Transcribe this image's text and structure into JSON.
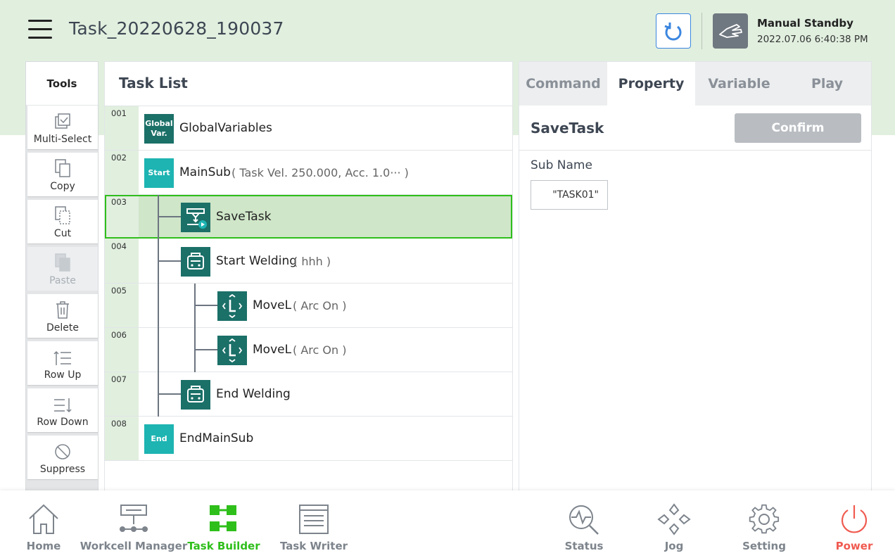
{
  "header": {
    "task_name": "Task_20220628_190037",
    "status_title": "Manual Standby",
    "status_time": "2022.07.06 6:40:38 PM"
  },
  "tools": {
    "title": "Tools",
    "items": [
      {
        "label": "Multi-Select",
        "icon": "multi-select-icon",
        "enabled": true
      },
      {
        "label": "Copy",
        "icon": "copy-icon",
        "enabled": true
      },
      {
        "label": "Cut",
        "icon": "cut-icon",
        "enabled": true
      },
      {
        "label": "Paste",
        "icon": "paste-icon",
        "enabled": false
      },
      {
        "label": "Delete",
        "icon": "trash-icon",
        "enabled": true
      },
      {
        "label": "Row Up",
        "icon": "row-up-icon",
        "enabled": true
      },
      {
        "label": "Row Down",
        "icon": "row-down-icon",
        "enabled": true
      },
      {
        "label": "Suppress",
        "icon": "suppress-icon",
        "enabled": true
      }
    ]
  },
  "task_list": {
    "title": "Task List",
    "rows": [
      {
        "num": "001",
        "node_text": "Global Var.",
        "label": "GlobalVariables",
        "arg": ""
      },
      {
        "num": "002",
        "node_text": "Start",
        "label": "MainSub",
        "arg": "( Task Vel. 250.000, Acc. 1.0··· )"
      },
      {
        "num": "003",
        "node_text": "",
        "label": "SaveTask",
        "arg": ""
      },
      {
        "num": "004",
        "node_text": "",
        "label": "Start Welding",
        "arg": "( hhh )"
      },
      {
        "num": "005",
        "node_text": "",
        "label": "MoveL",
        "arg": "( Arc On )"
      },
      {
        "num": "006",
        "node_text": "",
        "label": "MoveL",
        "arg": "( Arc On )"
      },
      {
        "num": "007",
        "node_text": "",
        "label": "End Welding",
        "arg": ""
      },
      {
        "num": "008",
        "node_text": "End",
        "label": "EndMainSub",
        "arg": ""
      }
    ],
    "selected_row": "003"
  },
  "property_panel": {
    "tabs": [
      "Command",
      "Property",
      "Variable",
      "Play"
    ],
    "active_tab": "Property",
    "title": "SaveTask",
    "confirm_label": "Confirm",
    "sub_name_label": "Sub Name",
    "sub_name_value": "\"TASK01\""
  },
  "bottom_nav": {
    "items": [
      {
        "label": "Home",
        "icon": "home-icon"
      },
      {
        "label": "Workcell Manager",
        "icon": "workcell-icon"
      },
      {
        "label": "Task Builder",
        "icon": "task-builder-icon"
      },
      {
        "label": "Task Writer",
        "icon": "task-writer-icon"
      },
      {
        "label": "Status",
        "icon": "status-icon"
      },
      {
        "label": "Jog",
        "icon": "jog-icon"
      },
      {
        "label": "Setting",
        "icon": "gear-icon"
      },
      {
        "label": "Power",
        "icon": "power-icon"
      }
    ],
    "active": "Task Builder"
  },
  "colors": {
    "header_bg": "#e1efdf",
    "accent_green": "#2fbf1b",
    "node_dark": "#1b7068",
    "node_teal": "#1db4b2",
    "power_red": "#f05a50",
    "selected_bg": "#cfe6c8"
  }
}
